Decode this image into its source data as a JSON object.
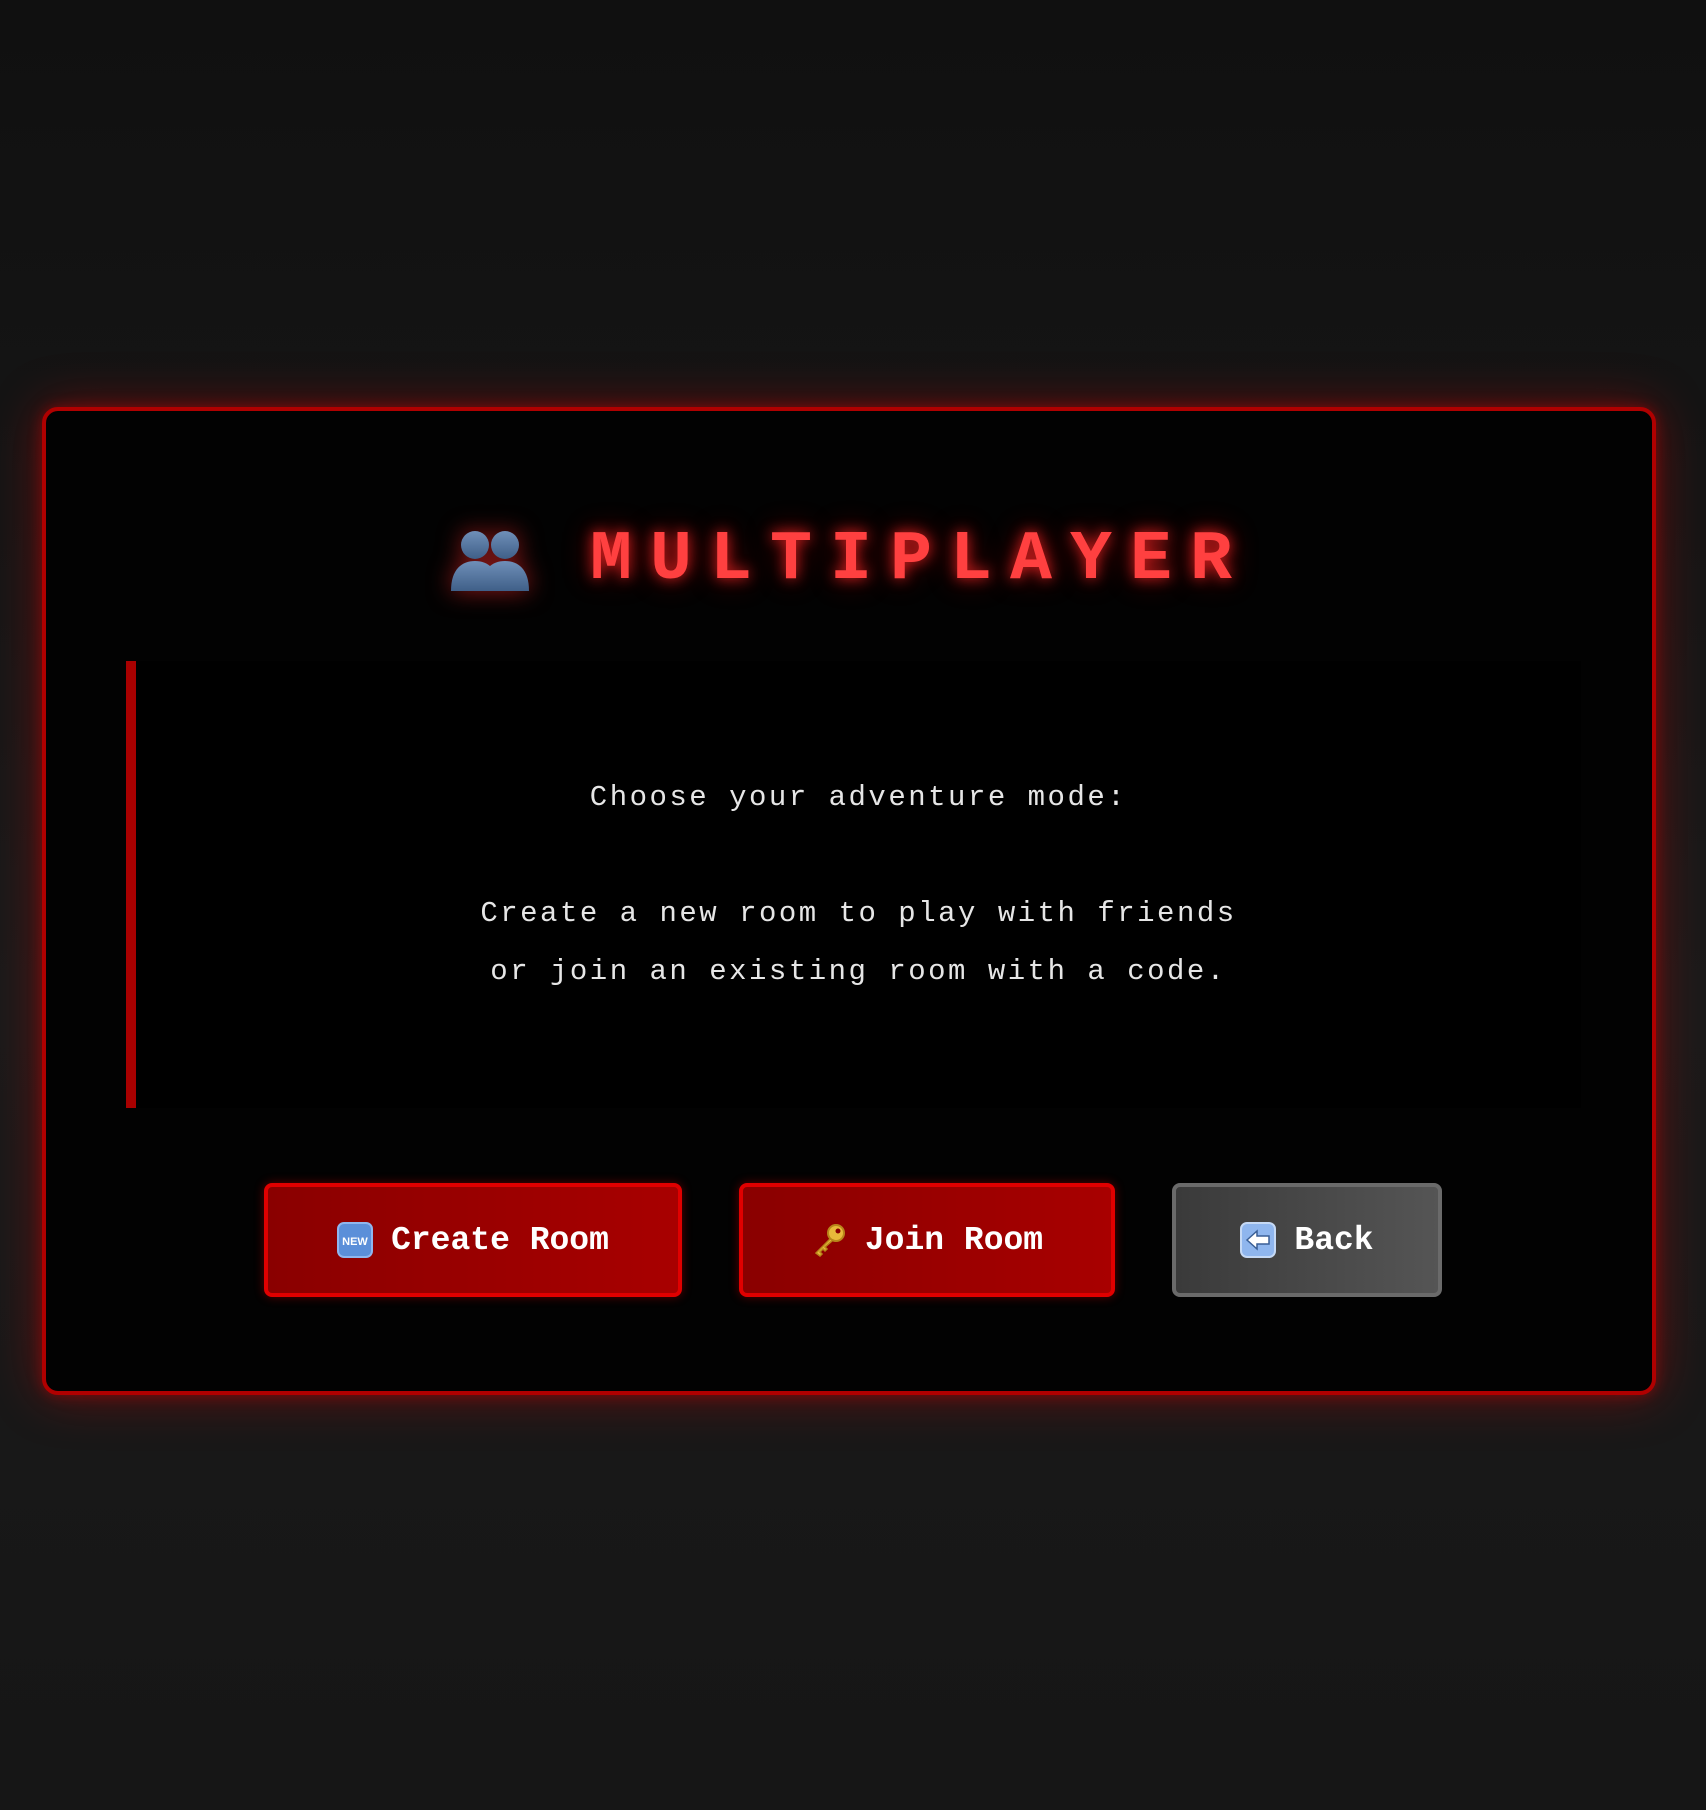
{
  "title": {
    "icon": "two-people-icon",
    "text": "MULTIPLAYER"
  },
  "info": {
    "heading": "Choose your adventure mode:",
    "line1": "Create a new room to play with friends",
    "line2": "or join an existing room with a code."
  },
  "buttons": {
    "create": {
      "icon": "new-badge-icon",
      "label": "Create Room"
    },
    "join": {
      "icon": "key-icon",
      "label": "Join Room"
    },
    "back": {
      "icon": "left-arrow-icon",
      "label": "Back"
    }
  },
  "colors": {
    "accent": "#ff4040",
    "border": "#b00000",
    "button_red": "#a80000",
    "button_gray": "#4a4a4a"
  }
}
